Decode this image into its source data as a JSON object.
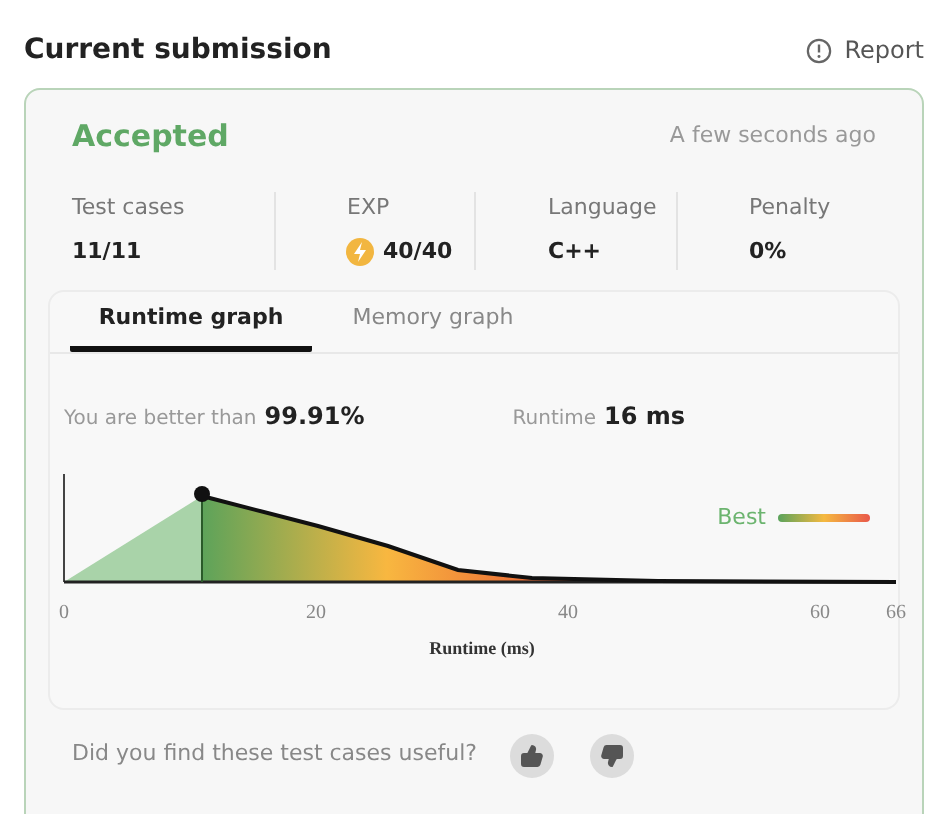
{
  "header": {
    "title": "Current submission",
    "report": "Report"
  },
  "result": {
    "status": "Accepted",
    "time": "A few seconds ago"
  },
  "stats": [
    {
      "label": "Test cases",
      "value": "11/11",
      "kind": "plain"
    },
    {
      "label": "EXP",
      "value": "40/40",
      "kind": "exp"
    },
    {
      "label": "Language",
      "value": "C++",
      "kind": "plain"
    },
    {
      "label": "Penalty",
      "value": "0%",
      "kind": "plain"
    }
  ],
  "tabs": [
    {
      "label": "Runtime graph",
      "selected": true
    },
    {
      "label": "Memory graph",
      "selected": false
    }
  ],
  "summary": {
    "better_label": "You are better than",
    "better_value": "99.91%",
    "runtime_label": "Runtime",
    "runtime_value": "16 ms"
  },
  "graph": {
    "legend": "Best",
    "x_ticks": [
      "0",
      "20",
      "40",
      "60",
      "66"
    ],
    "xlabel": "Runtime (ms)"
  },
  "feedback": {
    "question": "Did you find these test cases useful?"
  }
}
